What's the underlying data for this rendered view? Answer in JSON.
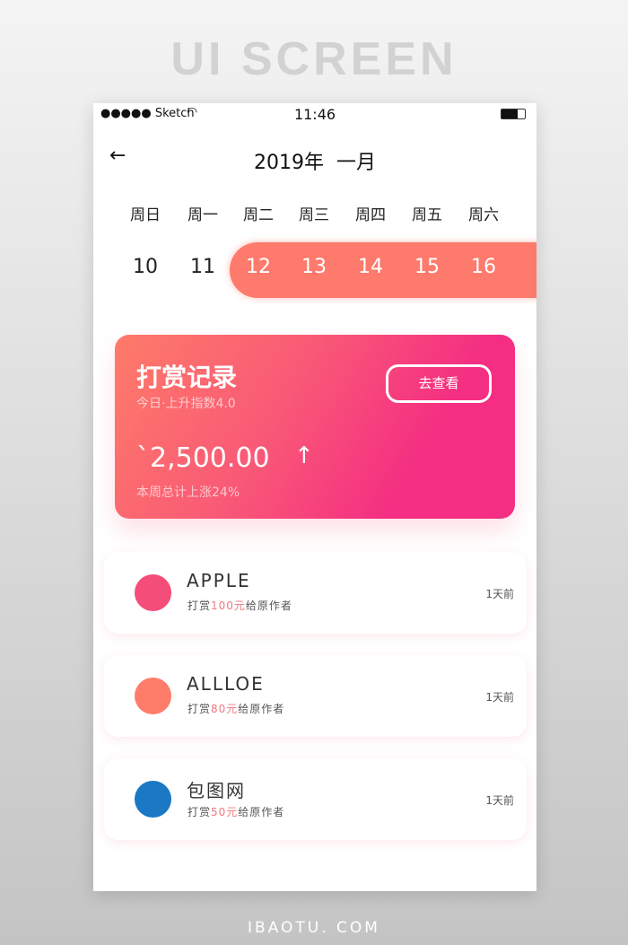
{
  "hero_title": "UI SCREEN",
  "footer": "IBAOTU. COM",
  "status": {
    "carrier": "●●●●● Sketch",
    "time": "11:46"
  },
  "header": {
    "title": "2019年  一月"
  },
  "weekdays": [
    "周日",
    "周一",
    "周二",
    "周三",
    "周四",
    "周五",
    "周六"
  ],
  "dates": [
    "10",
    "11",
    "12",
    "13",
    "14",
    "15",
    "16"
  ],
  "selected_range": [
    "12",
    "16"
  ],
  "card": {
    "title": "打赏记录",
    "subtitle": "今日·上升指数4.0",
    "button": "去查看",
    "amount": "`2,500.00",
    "trend_icon": "arrow-up",
    "note": "本周总计上涨24%"
  },
  "items": [
    {
      "name": "APPLE",
      "pre": "打赏",
      "amount": "100元",
      "post": "给原作者",
      "ago": "1天前",
      "color": "#f44d7a"
    },
    {
      "name": "ALLLOE",
      "pre": "打赏",
      "amount": "80元",
      "post": "给原作者",
      "ago": "1天前",
      "color": "#fd7d6a"
    },
    {
      "name": "包图网",
      "pre": "打赏",
      "amount": "50元",
      "post": "给原作者",
      "ago": "1天前",
      "color": "#1a78c4"
    }
  ],
  "colors": {
    "accent": "#fd7a6c",
    "gradient_end": "#f42e82"
  }
}
